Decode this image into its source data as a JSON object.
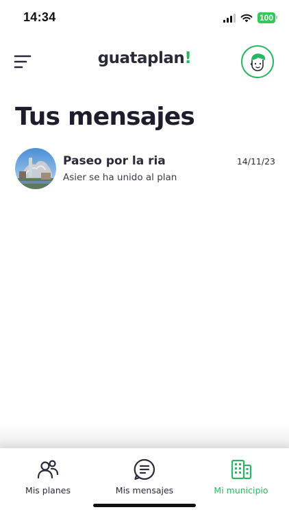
{
  "status_bar": {
    "time": "14:34",
    "battery": "100"
  },
  "header": {
    "logo_main": "guataplan",
    "logo_accent": "!"
  },
  "page": {
    "title": "Tus mensajes"
  },
  "messages": [
    {
      "title": "Paseo por la ria",
      "subtitle": "Asier se ha unido al plan",
      "date": "14/11/23"
    }
  ],
  "tabs": [
    {
      "label": "Mis planes",
      "icon": "people-icon",
      "active": false
    },
    {
      "label": "Mis mensajes",
      "icon": "message-icon",
      "active": false
    },
    {
      "label": "Mi municipio",
      "icon": "buildings-icon",
      "active": true
    }
  ],
  "colors": {
    "accent": "#2db462",
    "text": "#1d1d2b",
    "battery": "#34c759"
  }
}
